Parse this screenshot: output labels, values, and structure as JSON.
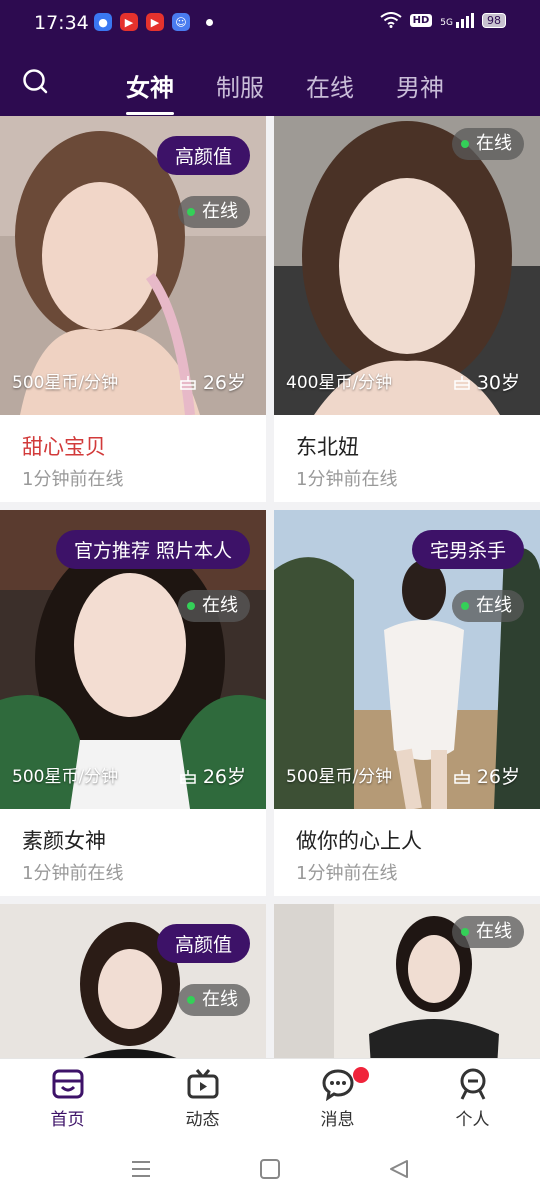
{
  "status_bar": {
    "time": "17:34",
    "wifi_icon": "wifi-icon",
    "hd_label": "HD",
    "signal_label": "5G",
    "battery": "98"
  },
  "nav": {
    "tabs": [
      {
        "label": "女神",
        "active": true
      },
      {
        "label": "制服",
        "active": false
      },
      {
        "label": "在线",
        "active": false
      },
      {
        "label": "男神",
        "active": false
      }
    ]
  },
  "cards": [
    {
      "name": "甜心宝贝",
      "status": "1分钟前在线",
      "tag": "高颜值",
      "online": "在线",
      "price": "500星币/分钟",
      "age": "26岁"
    },
    {
      "name": "东北妞",
      "status": "1分钟前在线",
      "tag": "",
      "online": "在线",
      "price": "400星币/分钟",
      "age": "30岁"
    },
    {
      "name": "素颜女神",
      "status": "1分钟前在线",
      "tag": "官方推荐 照片本人",
      "online": "在线",
      "price": "500星币/分钟",
      "age": "26岁"
    },
    {
      "name": "做你的心上人",
      "status": "1分钟前在线",
      "tag": "宅男杀手",
      "online": "在线",
      "price": "500星币/分钟",
      "age": "26岁"
    },
    {
      "tag": "高颜值",
      "online": "在线"
    },
    {
      "tag": "",
      "online": "在线"
    }
  ],
  "bottom_nav": {
    "items": [
      {
        "label": "首页",
        "icon": "home-icon",
        "active": true
      },
      {
        "label": "动态",
        "icon": "tv-icon",
        "active": false
      },
      {
        "label": "消息",
        "icon": "chat-icon",
        "active": false
      },
      {
        "label": "个人",
        "icon": "person-icon",
        "active": false
      }
    ]
  },
  "colors": {
    "brand": "#2d0b50",
    "accent": "#3d1268",
    "name_highlight": "#d23a3a",
    "online_dot": "#34d058"
  }
}
